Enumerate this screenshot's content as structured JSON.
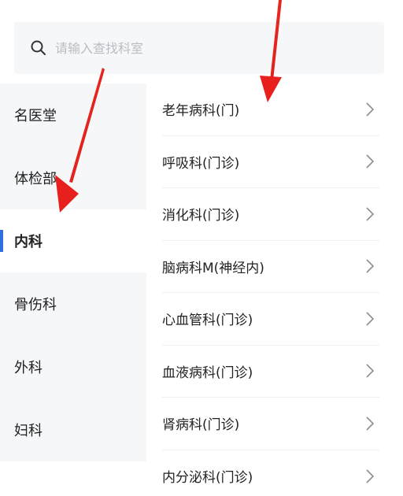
{
  "search": {
    "placeholder": "请输入查找科室",
    "value": ""
  },
  "sidebar": {
    "items": [
      {
        "label": "名医堂",
        "active": false
      },
      {
        "label": "体检部",
        "active": false
      },
      {
        "label": "内科",
        "active": true
      },
      {
        "label": "骨伤科",
        "active": false
      },
      {
        "label": "外科",
        "active": false
      },
      {
        "label": "妇科",
        "active": false
      }
    ]
  },
  "departments": [
    {
      "label": "老年病科(门)"
    },
    {
      "label": "呼吸科(门诊)"
    },
    {
      "label": "消化科(门诊)"
    },
    {
      "label": "脑病科M(神经内)"
    },
    {
      "label": "心血管科(门诊)"
    },
    {
      "label": "血液病科(门诊)"
    },
    {
      "label": "肾病科(门诊)"
    },
    {
      "label": "内分泌科(门诊)"
    }
  ],
  "colors": {
    "accent": "#2f6fde",
    "sidebar_bg": "#f6f7f9",
    "arrow": "#e8201d"
  },
  "icons": {
    "search": "search-icon",
    "chevron": "chevron-right-icon"
  }
}
